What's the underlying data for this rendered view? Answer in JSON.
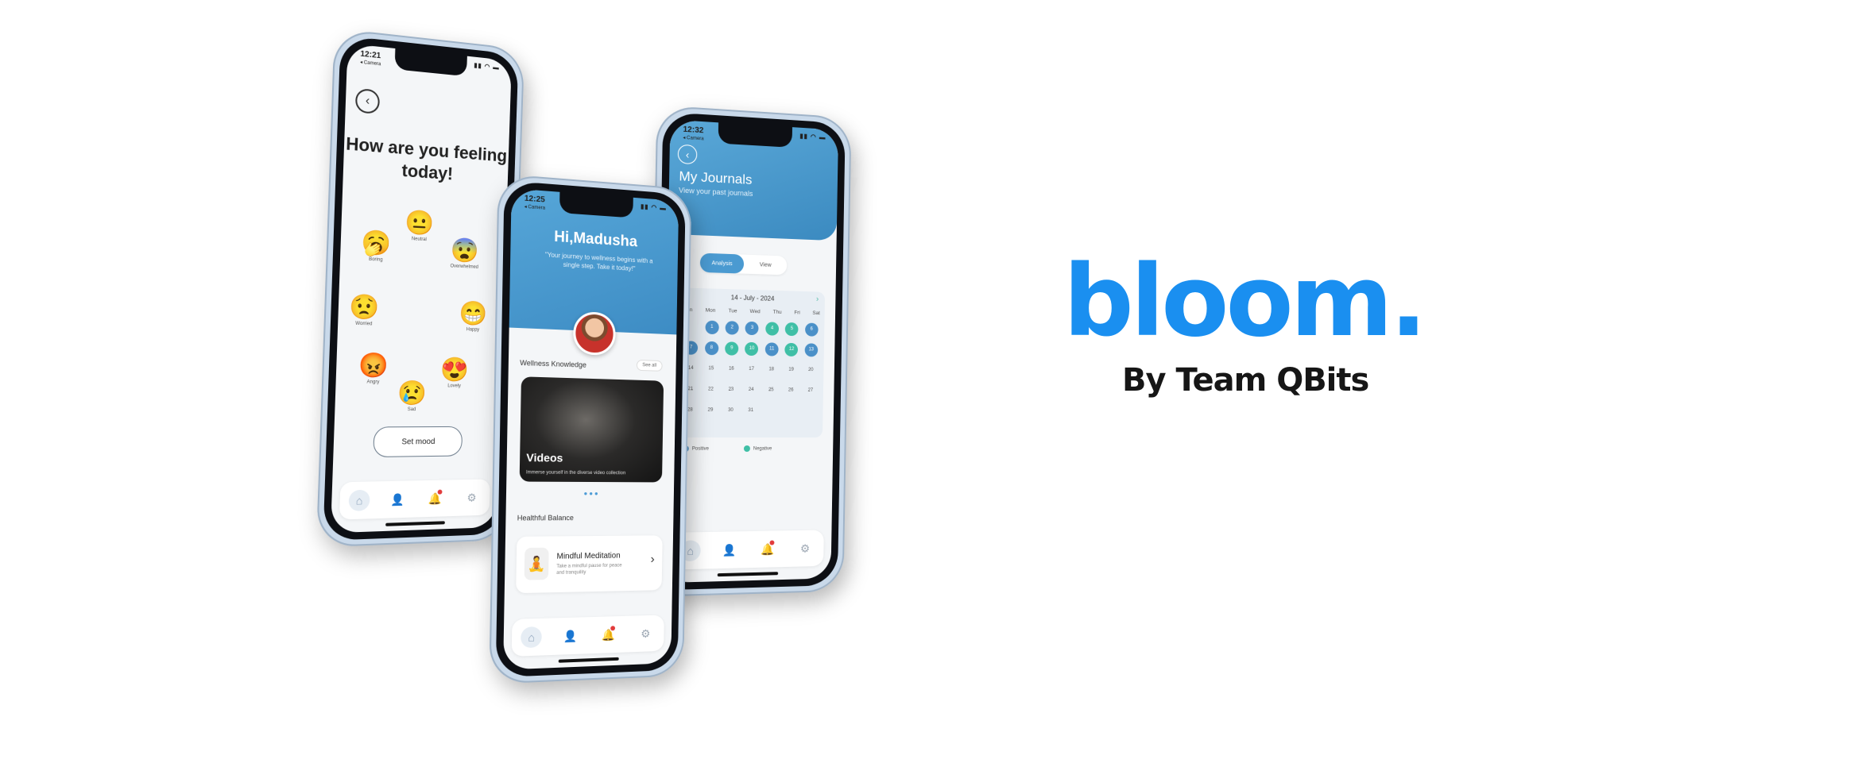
{
  "brand": {
    "name": "bloom.",
    "byline": "By Team QBits",
    "color": "#1a8ff0"
  },
  "mood_screen": {
    "time": "12:21",
    "carrier": "◂ Camera",
    "title": "How are you feeling today!",
    "moods": [
      {
        "label": "Boring",
        "icon": "yawning-face-icon",
        "face": "🥱"
      },
      {
        "label": "Neutral",
        "icon": "neutral-face-icon",
        "face": "😐"
      },
      {
        "label": "Overwhelmed",
        "icon": "fearful-face-icon",
        "face": "😨"
      },
      {
        "label": "Worried",
        "icon": "worried-face-icon",
        "face": "😟"
      },
      {
        "label": "Happy",
        "icon": "grinning-face-icon",
        "face": "😁"
      },
      {
        "label": "Angry",
        "icon": "angry-face-icon",
        "face": "😡"
      },
      {
        "label": "Lovely",
        "icon": "heart-eyes-icon",
        "face": "😍"
      },
      {
        "label": "Sad",
        "icon": "sad-face-icon",
        "face": "😢"
      }
    ],
    "set_mood_label": "Set mood"
  },
  "home_screen": {
    "time": "12:25",
    "carrier": "◂ Camera",
    "greeting": "Hi,Madusha",
    "subtitle": "\"Your journey to wellness begins with a single step. Take it today!\"",
    "wellness_title": "Wellness Knowledge",
    "see_all": "See all",
    "video_title": "Videos",
    "video_subtitle": "Immerse yourself in the diverse video collection",
    "balance_title": "Healthful Balance",
    "meditation_title": "Mindful Meditation",
    "meditation_subtitle": "Take a mindful pause for peace and tranquility"
  },
  "journal_screen": {
    "time": "12:32",
    "carrier": "◂ Camera",
    "title": "My Journals",
    "subtitle": "View your past journals",
    "tabs": [
      "Analysis",
      "View"
    ],
    "month": "14 - July - 2024",
    "weekdays": [
      "Sun",
      "Mon",
      "Tue",
      "Wed",
      "Thu",
      "Fri",
      "Sat"
    ],
    "legend": [
      "Positive",
      "Negative"
    ],
    "colors": {
      "positive": "#4a90c8",
      "negative": "#3fbfa6"
    },
    "days": [
      {
        "d": "",
        "s": ""
      },
      {
        "d": "1",
        "s": "p"
      },
      {
        "d": "2",
        "s": "p"
      },
      {
        "d": "3",
        "s": "p"
      },
      {
        "d": "4",
        "s": "n"
      },
      {
        "d": "5",
        "s": "n"
      },
      {
        "d": "6",
        "s": "p"
      },
      {
        "d": "7",
        "s": "p"
      },
      {
        "d": "8",
        "s": "p"
      },
      {
        "d": "9",
        "s": "n"
      },
      {
        "d": "10",
        "s": "n"
      },
      {
        "d": "11",
        "s": "p"
      },
      {
        "d": "12",
        "s": "n"
      },
      {
        "d": "13",
        "s": "p"
      },
      {
        "d": "14",
        "s": ""
      },
      {
        "d": "15",
        "s": ""
      },
      {
        "d": "16",
        "s": ""
      },
      {
        "d": "17",
        "s": ""
      },
      {
        "d": "18",
        "s": ""
      },
      {
        "d": "19",
        "s": ""
      },
      {
        "d": "20",
        "s": ""
      },
      {
        "d": "21",
        "s": ""
      },
      {
        "d": "22",
        "s": ""
      },
      {
        "d": "23",
        "s": ""
      },
      {
        "d": "24",
        "s": ""
      },
      {
        "d": "25",
        "s": ""
      },
      {
        "d": "26",
        "s": ""
      },
      {
        "d": "27",
        "s": ""
      },
      {
        "d": "28",
        "s": ""
      },
      {
        "d": "29",
        "s": ""
      },
      {
        "d": "30",
        "s": ""
      },
      {
        "d": "31",
        "s": ""
      }
    ]
  },
  "tabbar": {
    "icons": [
      "home-icon",
      "profile-icon",
      "notification-icon",
      "settings-icon"
    ],
    "glyphs": [
      "⌂",
      "👤",
      "🔔",
      "⚙"
    ]
  }
}
